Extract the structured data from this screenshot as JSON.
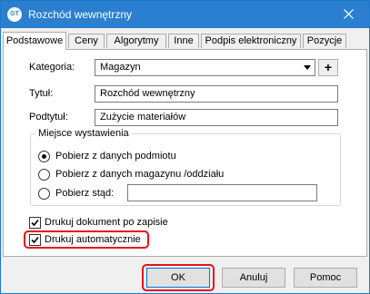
{
  "window": {
    "title": "Rozchód wewnętrzny",
    "icon": "GT"
  },
  "tabs": [
    {
      "label": "Podstawowe",
      "active": true
    },
    {
      "label": "Ceny"
    },
    {
      "label": "Algorytmy"
    },
    {
      "label": "Inne"
    },
    {
      "label": "Podpis elektroniczny"
    },
    {
      "label": "Pozycje"
    }
  ],
  "form": {
    "kategoria": {
      "label": "Kategoria:",
      "value": "Magazyn"
    },
    "tytul": {
      "label": "Tytuł:",
      "value": "Rozchód wewnętrzny"
    },
    "podtytul": {
      "label": "Podtytuł:",
      "value": "Zużycie materiałów"
    },
    "plus_label": "+"
  },
  "issue_place": {
    "title": "Miejsce wystawienia",
    "options": [
      {
        "label": "Pobierz z danych podmiotu",
        "checked": true
      },
      {
        "label": "Pobierz z danych magazynu /oddziału",
        "checked": false
      },
      {
        "label": "Pobierz stąd:",
        "checked": false
      }
    ],
    "custom_value": ""
  },
  "checkboxes": [
    {
      "label": "Drukuj dokument po zapisie",
      "checked": true
    },
    {
      "label": "Drukuj automatycznie",
      "checked": true
    }
  ],
  "buttons": {
    "ok": "OK",
    "cancel": "Anuluj",
    "help": "Pomoc"
  },
  "colors": {
    "titlebar": "#2b7fd0",
    "highlight": "#e8101b"
  }
}
